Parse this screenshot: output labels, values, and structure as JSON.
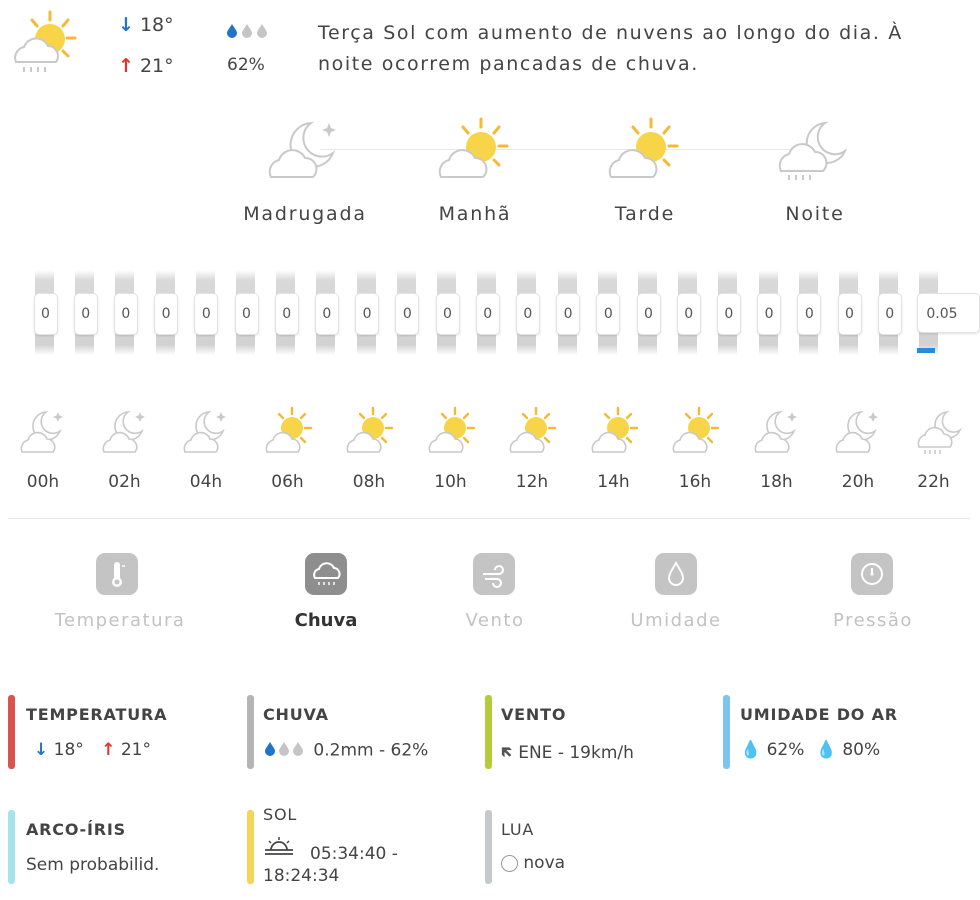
{
  "summary": {
    "min_temp": "18°",
    "max_temp": "21°",
    "rain_probability": "62%",
    "description_line1": "Terça Sol com aumento de nuvens ao longo do dia. À",
    "description_line2": "noite ocorrem pancadas de chuva."
  },
  "periods": [
    {
      "label": "Madrugada",
      "icon": "moon-cloud-icon"
    },
    {
      "label": "Manhã",
      "icon": "sun-cloud-icon"
    },
    {
      "label": "Tarde",
      "icon": "sun-cloud-icon"
    },
    {
      "label": "Noite",
      "icon": "moon-cloud-rain-icon"
    }
  ],
  "rain_values": [
    "0",
    "0",
    "0",
    "0",
    "0",
    "0",
    "0",
    "0",
    "0",
    "0",
    "0",
    "0",
    "0",
    "0",
    "0",
    "0",
    "0",
    "0",
    "0",
    "0",
    "0",
    "0",
    "0.05"
  ],
  "hourly": [
    {
      "label": "00h",
      "icon": "moon-cloud-icon"
    },
    {
      "label": "02h",
      "icon": "moon-cloud-icon"
    },
    {
      "label": "04h",
      "icon": "moon-cloud-icon"
    },
    {
      "label": "06h",
      "icon": "sun-cloud-icon"
    },
    {
      "label": "08h",
      "icon": "sun-cloud-icon"
    },
    {
      "label": "10h",
      "icon": "sun-cloud-icon"
    },
    {
      "label": "12h",
      "icon": "sun-cloud-icon"
    },
    {
      "label": "14h",
      "icon": "sun-cloud-icon"
    },
    {
      "label": "16h",
      "icon": "sun-cloud-icon"
    },
    {
      "label": "18h",
      "icon": "moon-cloud-icon"
    },
    {
      "label": "20h",
      "icon": "moon-cloud-icon"
    },
    {
      "label": "22h",
      "icon": "moon-cloud-rain-icon"
    }
  ],
  "tabs": [
    {
      "label": "Temperatura",
      "icon": "thermometer-icon",
      "active": false
    },
    {
      "label": "Chuva",
      "icon": "rain-cloud-icon",
      "active": true
    },
    {
      "label": "Vento",
      "icon": "wind-icon",
      "active": false
    },
    {
      "label": "Umidade",
      "icon": "drop-icon",
      "active": false
    },
    {
      "label": "Pressão",
      "icon": "gauge-icon",
      "active": false
    }
  ],
  "details": {
    "temperatura": {
      "title": "TEMPERATURA",
      "min": "18°",
      "max": "21°",
      "color": "#d9534f"
    },
    "chuva": {
      "title": "CHUVA",
      "value": "0.2mm - 62%",
      "color": "#b5b5b5"
    },
    "vento": {
      "title": "VENTO",
      "value": "ENE - 19km/h",
      "color": "#b5cc3a"
    },
    "umidade": {
      "title": "UMIDADE DO AR",
      "min": "62%",
      "max": "80%",
      "color": "#7fc3ef"
    },
    "arco_iris": {
      "title": "ARCO-ÍRIS",
      "value": "Sem probabilid.",
      "color": "#a7e3ec"
    },
    "sol": {
      "title": "SOL",
      "line1": "05:34:40 -",
      "line2": "18:24:34",
      "color": "#f6d35a"
    },
    "lua": {
      "title": "LUA",
      "value": "nova",
      "color": "#c5c9ce"
    }
  },
  "colors": {
    "sun": "#f8d548",
    "sun_rays": "#f4b936",
    "cloud_stroke": "#c9c9c9",
    "rain_fill": "#2a8bd8"
  }
}
